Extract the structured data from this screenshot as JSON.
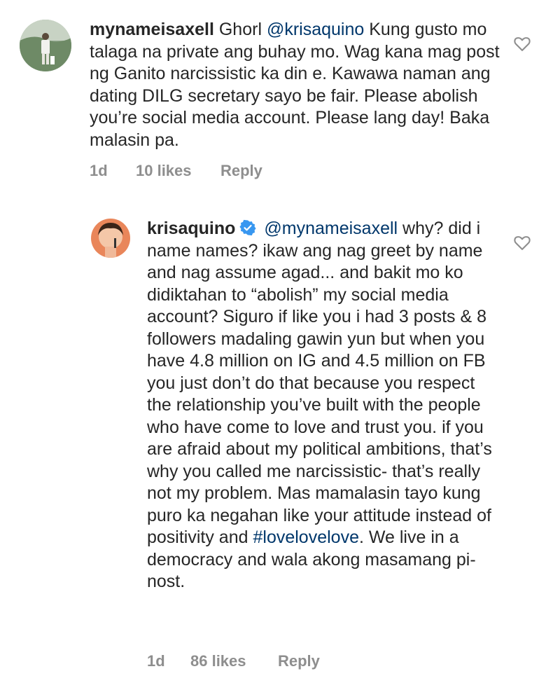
{
  "comments": [
    {
      "username": "mynameisaxell",
      "mention": "@krisaquino",
      "text_before": "Ghorl",
      "text_after": "Kung gusto mo talaga na private ang buhay mo. Wag kana mag post ng Ganito narcissistic ka din e. Kawawa naman ang dating DILG secretary sayo be fair. Please abolish you’re social media account. Please lang day! Baka malasin pa.",
      "time": "1d",
      "likes": "10 likes",
      "reply": "Reply",
      "avatar_icon": "user-avatar"
    },
    {
      "username": "krisaquino",
      "verified": true,
      "mention": "@mynameisaxell",
      "text_before": "why? did i name names? ikaw ang nag greet by name and nag assume agad... and bakit mo ko didiktahan to “abolish” my social media account? Siguro if like you i had 3 posts & 8 followers madaling gawin yun but when you have 4.8 million on IG and 4.5 million on FB you just don’t do that because you respect the relationship you’ve built with the people who have come to love and trust you. if you are afraid about my political ambitions, that’s why you called me narcissistic- that’s really not my problem. Mas mamalasin tayo kung puro ka negahan like your attitude instead of positivity and",
      "hashtag": "#lovelovelove",
      "text_after": ". We live in a democracy and wala akong masamang pi-nost.",
      "time": "1d",
      "likes": "86 likes",
      "reply": "Reply",
      "avatar_icon": "user-avatar"
    }
  ],
  "icons": {
    "like": "heart-outline-icon",
    "verified": "verified-badge-icon"
  },
  "colors": {
    "text": "#262626",
    "meta": "#8e8e8e",
    "link": "#00376b",
    "verified": "#3897f0"
  }
}
